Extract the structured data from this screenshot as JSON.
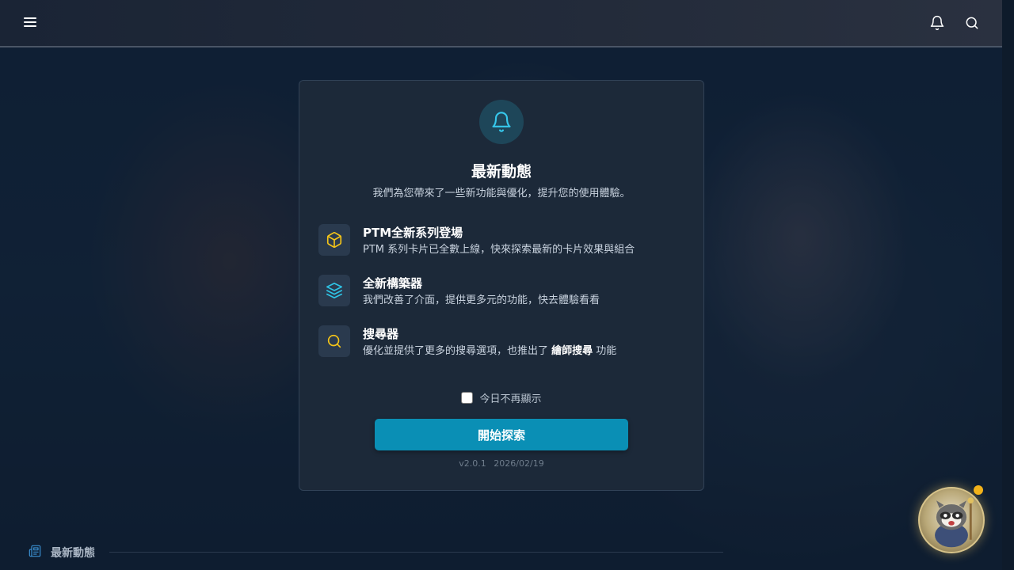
{
  "header": {
    "menu_icon": "menu-icon",
    "notification_icon": "bell-icon",
    "search_icon": "search-icon"
  },
  "modal": {
    "icon": "bell-icon",
    "title": "最新動態",
    "subtitle": "我們為您帶來了一些新功能與優化，提升您的使用體驗。",
    "features": [
      {
        "icon": "cube-icon",
        "icon_color": "#f5c518",
        "title": "PTM全新系列登場",
        "desc": "PTM 系列卡片已全數上線，快來探索最新的卡片效果與組合"
      },
      {
        "icon": "layers-icon",
        "icon_color": "#2ec4e6",
        "title": "全新構築器",
        "desc": "我們改善了介面，提供更多元的功能，快去體驗看看"
      },
      {
        "icon": "search-icon",
        "icon_color": "#f5c518",
        "title": "搜尋器",
        "desc_prefix": "優化並提供了更多的搜尋選項，也推出了 ",
        "desc_bold": "繪師搜尋",
        "desc_suffix": " 功能"
      }
    ],
    "dont_show_label": "今日不再顯示",
    "dont_show_checked": false,
    "start_button": "開始探索",
    "version": "v2.0.1",
    "date": "2026/02/19"
  },
  "news_section": {
    "icon": "newspaper-icon",
    "title": "最新動態"
  },
  "mascot": {
    "icon": "raccoon-mascot",
    "has_notification": true,
    "badge_color": "#f2b21a"
  },
  "colors": {
    "accent": "#0a8fb5",
    "background": "#0f2136",
    "modal_bg": "#1c2939"
  }
}
